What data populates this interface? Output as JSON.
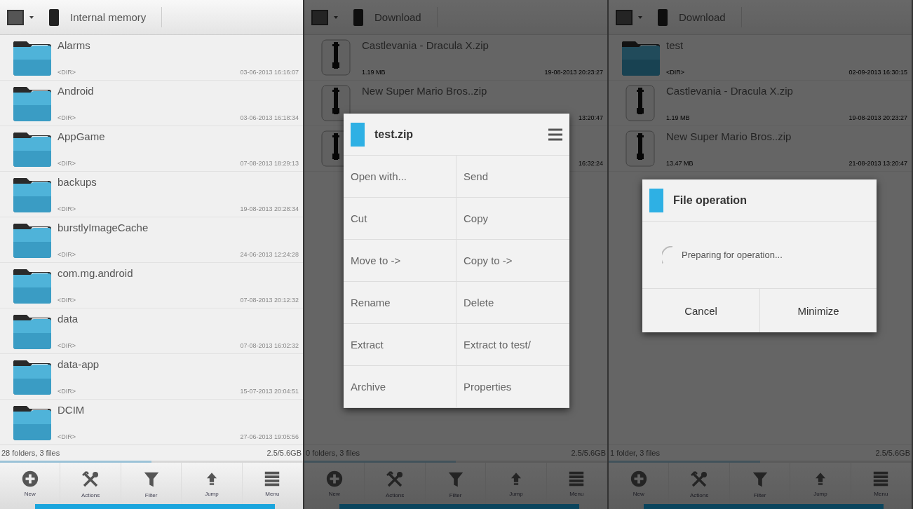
{
  "panels": [
    {
      "dimmed": false,
      "breadcrumb": "Internal memory",
      "items": [
        {
          "kind": "folder",
          "name": "Alarms",
          "size": "<DIR>",
          "date": "03-06-2013 16:16:07"
        },
        {
          "kind": "folder",
          "name": "Android",
          "size": "<DIR>",
          "date": "03-06-2013 16:18:34"
        },
        {
          "kind": "folder",
          "name": "AppGame",
          "size": "<DIR>",
          "date": "07-08-2013 18:29:13"
        },
        {
          "kind": "folder",
          "name": "backups",
          "size": "<DIR>",
          "date": "19-08-2013 20:28:34"
        },
        {
          "kind": "folder",
          "name": "burstlyImageCache",
          "size": "<DIR>",
          "date": "24-06-2013 12:24:28"
        },
        {
          "kind": "folder",
          "name": "com.mg.android",
          "size": "<DIR>",
          "date": "07-08-2013 20:12:32"
        },
        {
          "kind": "folder",
          "name": "data",
          "size": "<DIR>",
          "date": "07-08-2013 16:02:32"
        },
        {
          "kind": "folder",
          "name": "data-app",
          "size": "<DIR>",
          "date": "15-07-2013 20:04:51"
        },
        {
          "kind": "folder",
          "name": "DCIM",
          "size": "<DIR>",
          "date": "27-06-2013 19:05:56"
        }
      ],
      "status": "28 folders, 3 files",
      "storage": "2.5/5.6GB",
      "toolbar": [
        {
          "kind": "new",
          "label": "New"
        },
        {
          "kind": "actions",
          "label": "Actions"
        },
        {
          "kind": "filter",
          "label": "Filter"
        },
        {
          "kind": "jump",
          "label": "Jump"
        },
        {
          "kind": "menu",
          "label": "Menu"
        }
      ]
    },
    {
      "dimmed": true,
      "breadcrumb": "Download",
      "items": [
        {
          "kind": "zip",
          "name": "Castlevania - Dracula X.zip",
          "size": "1.19 MB",
          "date": "19-08-2013 20:23:27"
        },
        {
          "kind": "zip",
          "name": "New Super Mario Bros..zip",
          "date": "13:20:47"
        },
        {
          "kind": "zip",
          "date": "16:32:24"
        }
      ],
      "status": "0 folders, 3 files",
      "storage": "2.5/5.6GB",
      "toolbar": [
        {
          "kind": "new",
          "label": "New"
        },
        {
          "kind": "actions",
          "label": "Actions"
        },
        {
          "kind": "filter",
          "label": "Filter"
        },
        {
          "kind": "jump",
          "label": "Jump"
        },
        {
          "kind": "menu",
          "label": "Menu"
        }
      ],
      "dialog": {
        "kind": "menu",
        "title": "test.zip",
        "options": [
          "Open with...",
          "Send",
          "Cut",
          "Copy",
          "Move to ->",
          "Copy to ->",
          "Rename",
          "Delete",
          "Extract",
          "Extract to test/",
          "Archive",
          "Properties"
        ]
      }
    },
    {
      "dimmed": true,
      "breadcrumb": "Download",
      "items": [
        {
          "kind": "folder",
          "name": "test",
          "size": "<DIR>",
          "date": "02-09-2013 16:30:15"
        },
        {
          "kind": "zip",
          "name": "Castlevania - Dracula X.zip",
          "size": "1.19 MB",
          "date": "19-08-2013 20:23:27"
        },
        {
          "kind": "zip",
          "name": "New Super Mario Bros..zip",
          "size": "13.47 MB",
          "date": "21-08-2013 13:20:47"
        }
      ],
      "status": "1 folder, 3 files",
      "storage": "2.5/5.6GB",
      "toolbar": [
        {
          "kind": "new",
          "label": "New"
        },
        {
          "kind": "actions",
          "label": "Actions"
        },
        {
          "kind": "filter",
          "label": "Filter"
        },
        {
          "kind": "jump",
          "label": "Jump"
        },
        {
          "kind": "menu",
          "label": "Menu"
        }
      ],
      "dialog": {
        "kind": "progress",
        "title": "File operation",
        "message": "Preparing for operation...",
        "buttons": [
          "Cancel",
          "Minimize"
        ]
      }
    }
  ]
}
